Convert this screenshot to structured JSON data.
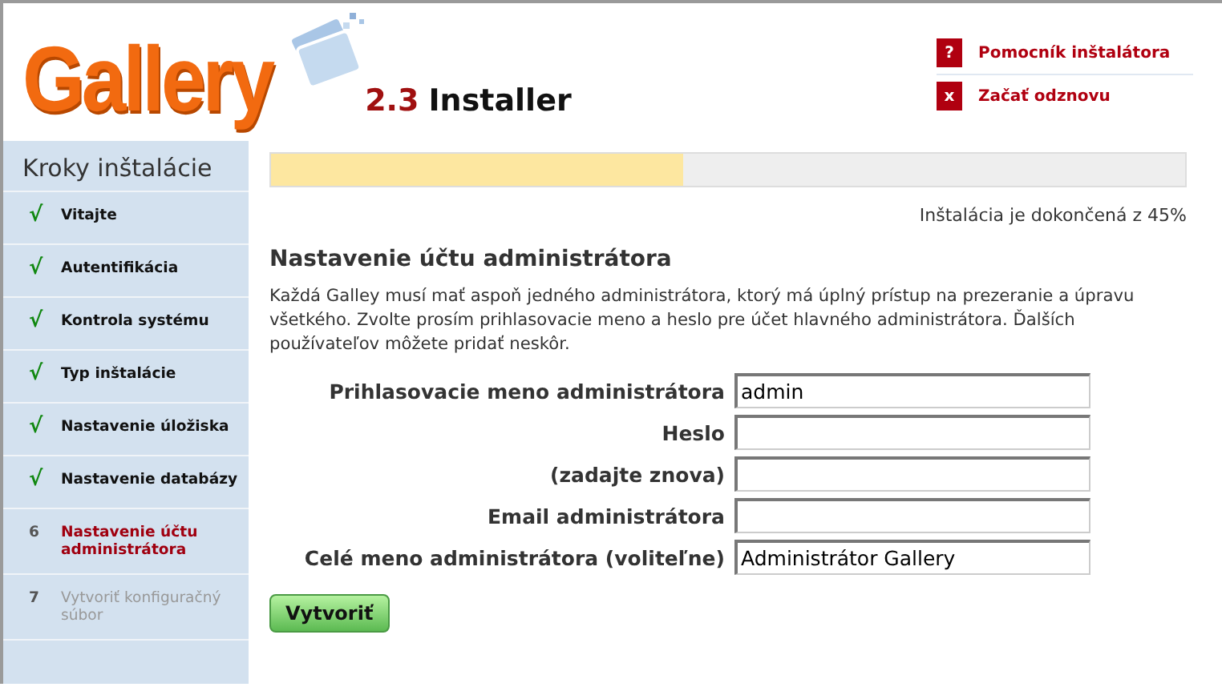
{
  "logo": {
    "name": "Gallery",
    "version": "2.3",
    "product": "Installer"
  },
  "header_links": [
    {
      "icon": "?",
      "label": "Pomocník inštalátora"
    },
    {
      "icon": "x",
      "label": "Začať odznovu"
    }
  ],
  "sidebar": {
    "title": "Kroky inštalácie",
    "items": [
      {
        "marker": "√",
        "label": "Vitajte",
        "done": true,
        "selected": false
      },
      {
        "marker": "√",
        "label": "Autentifikácia",
        "done": true,
        "selected": false
      },
      {
        "marker": "√",
        "label": "Kontrola systému",
        "done": true,
        "selected": false
      },
      {
        "marker": "√",
        "label": "Typ inštalácie",
        "done": true,
        "selected": false
      },
      {
        "marker": "√",
        "label": "Nastavenie úložiska",
        "done": true,
        "selected": false
      },
      {
        "marker": "√",
        "label": "Nastavenie databázy",
        "done": true,
        "selected": false
      },
      {
        "marker": "6",
        "label": "Nastavenie účtu administrátora",
        "done": false,
        "selected": true
      },
      {
        "marker": "7",
        "label": "Vytvoriť konfiguračný súbor",
        "done": false,
        "selected": false
      }
    ]
  },
  "progress": {
    "level": 0.45,
    "caption": "Inštalácia je dokončená z 45%"
  },
  "heading": "Nastavenie účtu administrátora",
  "description": "Každá Galley musí mať aspoň jedného administrátora, ktorý má úplný prístup na prezeranie a úpravu všetkého. Zvolte prosím prihlasovacie meno a heslo pre účet hlavného administrátora. Ďalších používateľov môžete pridať neskôr.",
  "fields": [
    {
      "label": "Prihlasovacie meno administrátora",
      "value": "admin"
    },
    {
      "label": "Heslo"
    },
    {
      "label": "(zadajte znova)"
    },
    {
      "label": "Email administrátora"
    },
    {
      "label": "Celé meno administrátora (voliteľne)",
      "value": "Administrátor Gallery"
    }
  ],
  "submit": "Vytvoriť"
}
